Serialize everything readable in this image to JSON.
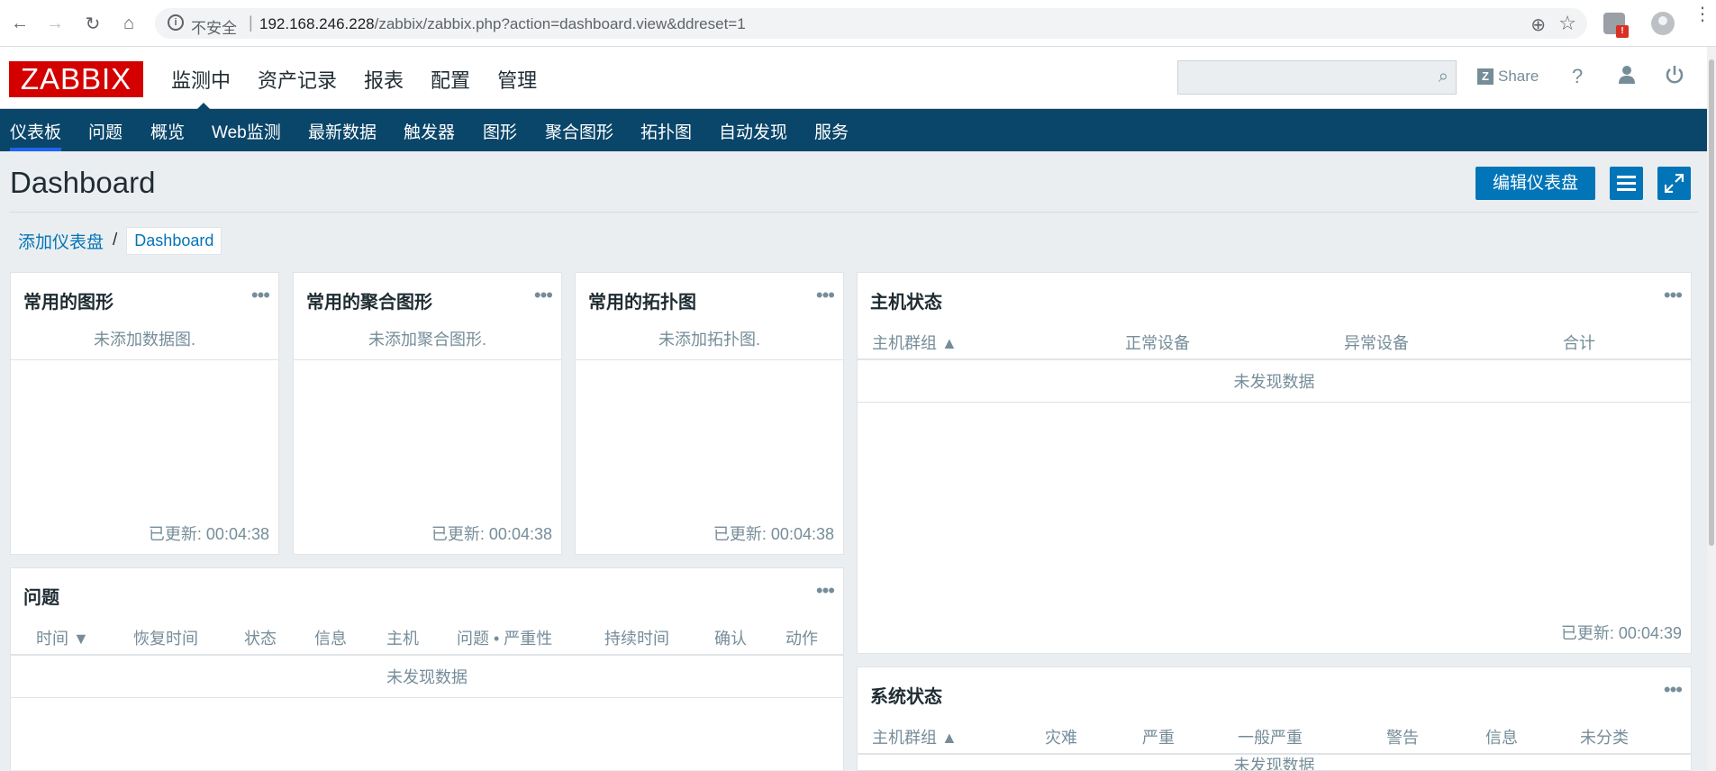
{
  "browser": {
    "insecure_label": "不安全",
    "url_host": "192.168.246.228",
    "url_path": "/zabbix/zabbix.php?action=dashboard.view&ddreset=1",
    "extension_badge": "!"
  },
  "header": {
    "logo": "ZABBIX",
    "main_menu": [
      "监测中",
      "资产记录",
      "报表",
      "配置",
      "管理"
    ],
    "search_placeholder": "",
    "share_label": "Share",
    "help_label": "?"
  },
  "subnav": {
    "items": [
      "仪表板",
      "问题",
      "概览",
      "Web监测",
      "最新数据",
      "触发器",
      "图形",
      "聚合图形",
      "拓扑图",
      "自动发现",
      "服务"
    ]
  },
  "page": {
    "title": "Dashboard",
    "edit_button": "编辑仪表盘",
    "breadcrumb": [
      "添加仪表盘",
      "Dashboard"
    ],
    "breadcrumb_sep": "/"
  },
  "widgets": {
    "fav_graphs": {
      "title": "常用的图形",
      "empty": "未添加数据图.",
      "updated": "已更新: 00:04:38"
    },
    "fav_screens": {
      "title": "常用的聚合图形",
      "empty": "未添加聚合图形.",
      "updated": "已更新: 00:04:38"
    },
    "fav_maps": {
      "title": "常用的拓扑图",
      "empty": "未添加拓扑图.",
      "updated": "已更新: 00:04:38"
    },
    "host_status": {
      "title": "主机状态",
      "columns": [
        "主机群组 ▲",
        "正常设备",
        "异常设备",
        "合计"
      ],
      "empty": "未发现数据",
      "updated": "已更新: 00:04:39"
    },
    "problems": {
      "title": "问题",
      "columns": [
        "时间 ▼",
        "恢复时间",
        "状态",
        "信息",
        "主机",
        "问题 • 严重性",
        "持续时间",
        "确认",
        "动作"
      ],
      "empty": "未发现数据"
    },
    "system_status": {
      "title": "系统状态",
      "columns": [
        "主机群组 ▲",
        "灾难",
        "严重",
        "一般严重",
        "警告",
        "信息",
        "未分类"
      ],
      "empty": "未发现数据"
    }
  },
  "colors": {
    "brand": "#d40000",
    "subnav_bg": "#0a466a",
    "accent": "#0275b8"
  }
}
